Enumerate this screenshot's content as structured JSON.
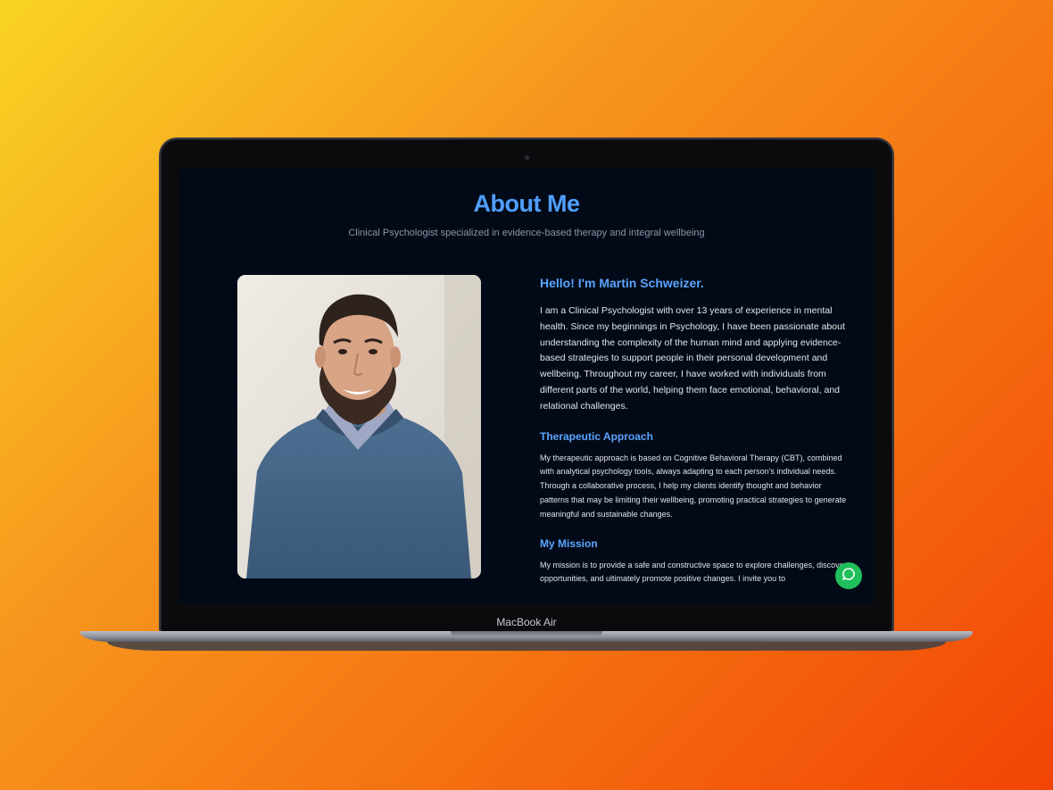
{
  "device": {
    "model_label": "MacBook Air"
  },
  "page": {
    "title": "About Me",
    "subtitle": "Clinical Psychologist specialized in evidence-based therapy and integral wellbeing"
  },
  "profile": {
    "greeting": "Hello! I'm Martin Schweizer.",
    "intro": "I am a Clinical Psychologist with over 13 years of experience in mental health. Since my beginnings in Psychology, I have been passionate about understanding the complexity of the human mind and applying evidence-based strategies to support people in their personal development and wellbeing. Throughout my career, I have worked with individuals from different parts of the world, helping them face emotional, behavioral, and relational challenges."
  },
  "sections": [
    {
      "heading": "Therapeutic Approach",
      "text": "My therapeutic approach is based on Cognitive Behavioral Therapy (CBT), combined with analytical psychology tools, always adapting to each person's individual needs. Through a collaborative process, I help my clients identify thought and behavior patterns that may be limiting their wellbeing, promoting practical strategies to generate meaningful and sustainable changes."
    },
    {
      "heading": "My Mission",
      "text": "My mission is to provide a safe and constructive space to explore challenges, discover opportunities, and ultimately promote positive changes. I invite you to"
    }
  ],
  "chat_button": {
    "icon": "chat-bubble-icon"
  },
  "colors": {
    "accent": "#4f9fff",
    "background": "#030a17",
    "chat_green": "#1fbf5a"
  }
}
